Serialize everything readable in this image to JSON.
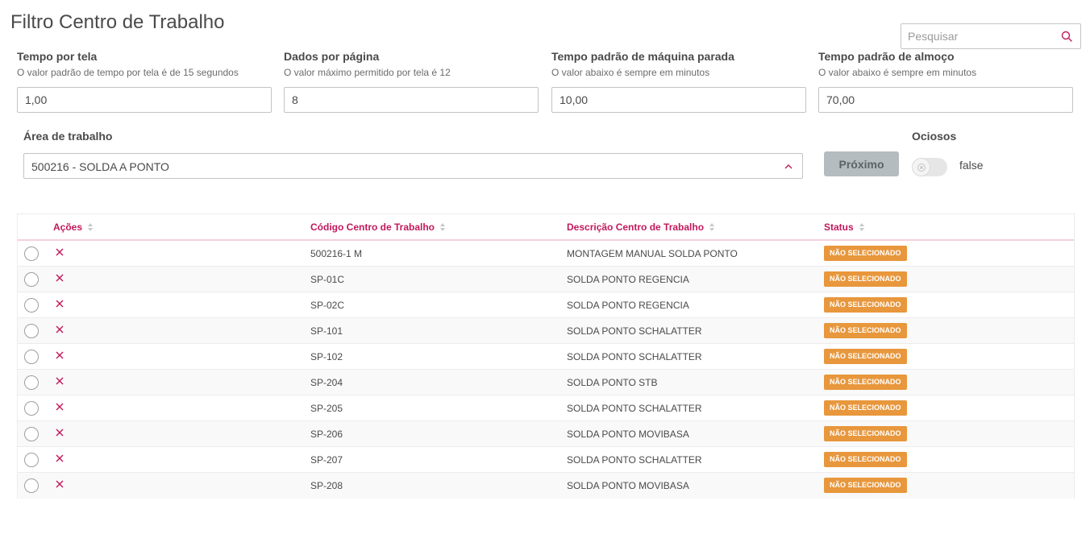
{
  "page": {
    "title": "Filtro Centro de Trabalho"
  },
  "search": {
    "placeholder": "Pesquisar",
    "icon": "search-icon"
  },
  "fields": [
    {
      "label": "Tempo por tela",
      "help": "O valor padrão de tempo por tela é de 15 segundos",
      "value": "1,00"
    },
    {
      "label": "Dados por página",
      "help": "O valor máximo permitido por tela é 12",
      "value": "8"
    },
    {
      "label": "Tempo padrão de máquina parada",
      "help": "O valor abaixo é sempre em minutos",
      "value": "10,00"
    },
    {
      "label": "Tempo padrão de almoço",
      "help": "O valor abaixo é sempre em minutos",
      "value": "70,00"
    }
  ],
  "area": {
    "label": "Área de trabalho",
    "selected": "500216 - SOLDA A PONTO"
  },
  "next_button": {
    "label": "Próximo"
  },
  "ociosos": {
    "label": "Ociosos",
    "toggle_text": "false",
    "on": false
  },
  "table": {
    "headers": {
      "acoes": "Ações",
      "codigo": "Código Centro de Trabalho",
      "descricao": "Descrição Centro de Trabalho",
      "status": "Status"
    },
    "rows": [
      {
        "codigo": "500216-1 M",
        "descricao": "MONTAGEM MANUAL SOLDA PONTO",
        "status": "NÃO SELECIONADO"
      },
      {
        "codigo": "SP-01C",
        "descricao": "SOLDA PONTO REGENCIA",
        "status": "NÃO SELECIONADO"
      },
      {
        "codigo": "SP-02C",
        "descricao": "SOLDA PONTO REGENCIA",
        "status": "NÃO SELECIONADO"
      },
      {
        "codigo": "SP-101",
        "descricao": "SOLDA PONTO SCHALATTER",
        "status": "NÃO SELECIONADO"
      },
      {
        "codigo": "SP-102",
        "descricao": "SOLDA PONTO SCHALATTER",
        "status": "NÃO SELECIONADO"
      },
      {
        "codigo": "SP-204",
        "descricao": "SOLDA PONTO STB",
        "status": "NÃO SELECIONADO"
      },
      {
        "codigo": "SP-205",
        "descricao": "SOLDA PONTO SCHALATTER",
        "status": "NÃO SELECIONADO"
      },
      {
        "codigo": "SP-206",
        "descricao": "SOLDA PONTO MOVIBASA",
        "status": "NÃO SELECIONADO"
      },
      {
        "codigo": "SP-207",
        "descricao": "SOLDA PONTO SCHALATTER",
        "status": "NÃO SELECIONADO"
      },
      {
        "codigo": "SP-208",
        "descricao": "SOLDA PONTO MOVIBASA",
        "status": "NÃO SELECIONADO"
      }
    ]
  },
  "colors": {
    "accent": "#c2185b",
    "badge": "#e8973c",
    "button": "#b4bcbf"
  }
}
